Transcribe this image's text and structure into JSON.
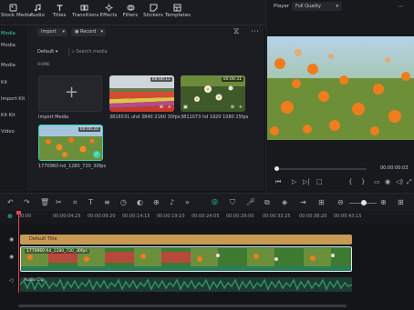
{
  "toolbar": {
    "items": [
      {
        "label": "Stock Media",
        "icon": "stock-media-icon"
      },
      {
        "label": "Audio",
        "icon": "audio-icon"
      },
      {
        "label": "Titles",
        "icon": "titles-icon"
      },
      {
        "label": "Transitions",
        "icon": "transitions-icon"
      },
      {
        "label": "Effects",
        "icon": "effects-icon"
      },
      {
        "label": "Filters",
        "icon": "filters-icon"
      },
      {
        "label": "Stickers",
        "icon": "stickers-icon"
      },
      {
        "label": "Templates",
        "icon": "templates-icon"
      }
    ]
  },
  "sidebar": {
    "items": [
      {
        "label": "Media",
        "active": true
      },
      {
        "label": "Media"
      },
      {
        "label": "Media"
      },
      {
        "label": "Kit"
      },
      {
        "label": "Import Kit"
      },
      {
        "label": "Kit Kit"
      },
      {
        "label": "Video"
      }
    ]
  },
  "media": {
    "import_label": "Import",
    "record_label": "Record",
    "sort_label": "Default",
    "search_placeholder": "Search media",
    "section_label": "HOME",
    "import_tile_label": "Import Media",
    "items": [
      {
        "duration": "00:00:11",
        "caption": "3816531 uhd 3840 2160 30fps"
      },
      {
        "duration": "00:00:31",
        "caption": "3811073 hd 1920 1080 25fps"
      },
      {
        "duration": "00:00:20",
        "caption": "1770960-hd_1280_720_30fps",
        "selected": true
      }
    ]
  },
  "player": {
    "label": "Player",
    "quality": "Full Quality",
    "timecode": "00:00:00:03"
  },
  "timeline": {
    "ruler": [
      "00:00",
      "00:00:04:25",
      "00:00:09:20",
      "00:00:14:15",
      "00:00:19:10",
      "00:00:24:05",
      "00:00:29:00",
      "00:00:33:25",
      "00:00:38:20",
      "00:00:43:15"
    ],
    "title_clip": "Default Title",
    "video_clip": "1770960-hd_1280_720_30fps",
    "audio_clip": "Audio Clip"
  },
  "colors": {
    "accent": "#35d3b4",
    "title_clip": "#c79a55",
    "video_track": "#2a7d5a",
    "audio_wave": "#2d8f6c",
    "playhead": "#e0464a"
  }
}
